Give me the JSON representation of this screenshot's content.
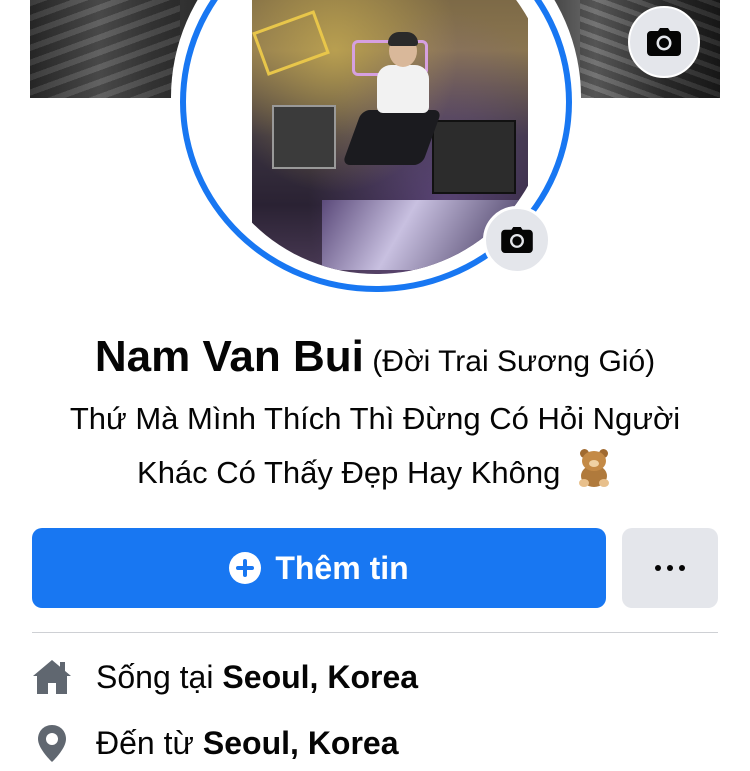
{
  "profile": {
    "name": "Nam Van Bui",
    "alternate_name": "(Đời Trai Sương Gió)",
    "bio_line1": "Thứ Mà Mình Thích Thì Đừng Có Hỏi Người",
    "bio_line2": "Khác Có Thấy Đẹp Hay Không"
  },
  "icons": {
    "cover_camera": "camera-icon",
    "avatar_camera": "camera-icon",
    "add": "plus-circle-icon",
    "more": "more-dots-icon",
    "lives_in": "home-icon",
    "from": "location-pin-icon",
    "bio_emoji": "teddy-bear-emoji"
  },
  "actions": {
    "add_info_label": "Thêm tin"
  },
  "details": [
    {
      "prefix": "Sống tại",
      "value": "Seoul, Korea"
    },
    {
      "prefix": "Đến từ",
      "value": "Seoul, Korea"
    }
  ],
  "colors": {
    "accent": "#1877f2",
    "secondary_button": "#e4e6eb",
    "text": "#050505"
  }
}
